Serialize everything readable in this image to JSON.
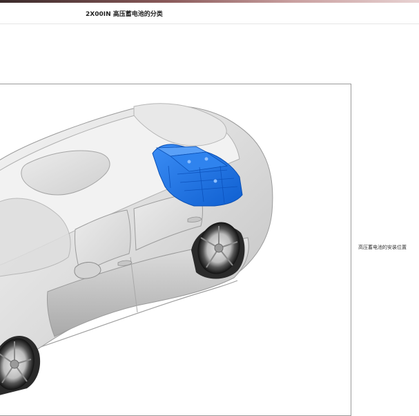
{
  "header": {
    "title": "2X00IN 高压蓄电池的分类"
  },
  "figure": {
    "caption": "高压蓄电池的安装位置",
    "highlight_color": "#1e73e8",
    "body_color": "#e4e4e4"
  }
}
